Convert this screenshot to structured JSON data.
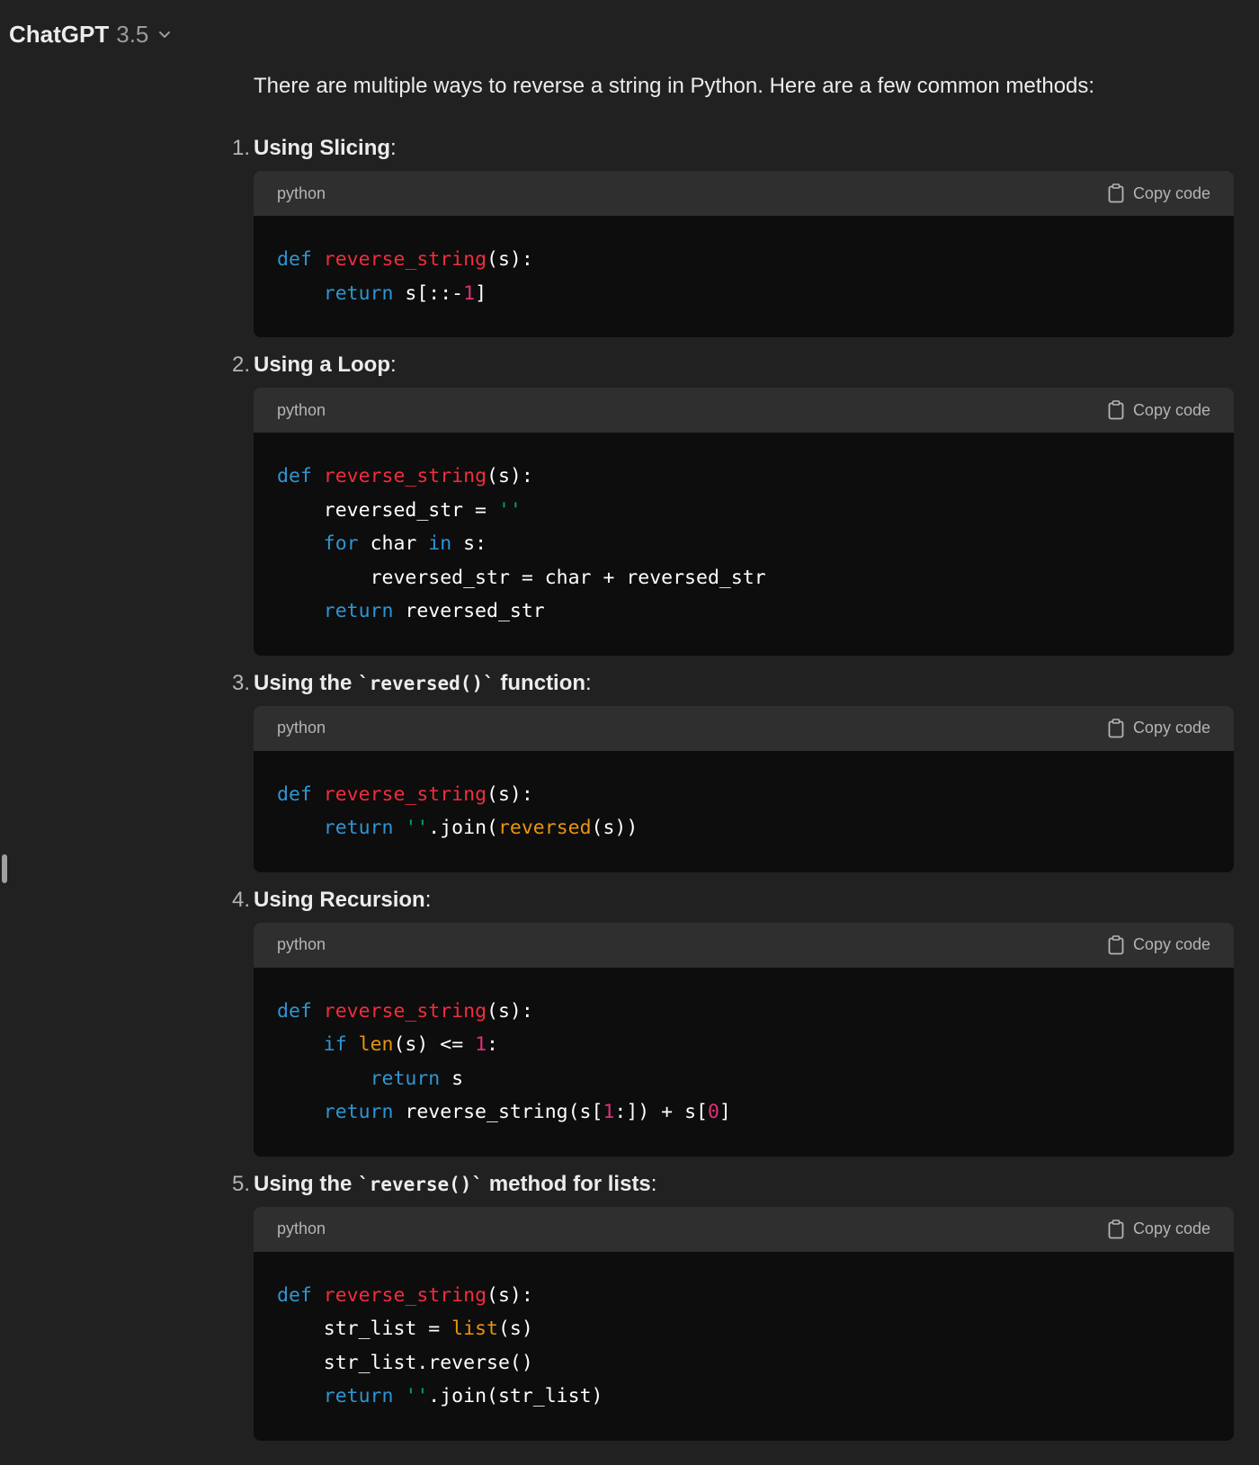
{
  "header": {
    "title": "ChatGPT",
    "version": "3.5"
  },
  "intro": "There are multiple ways to reverse a string in Python. Here are a few common methods:",
  "copy_label": "Copy code",
  "items": [
    {
      "number": "1.",
      "title": "Using Slicing",
      "lang": "python",
      "code": [
        [
          "def",
          "reverse_string",
          "(s):"
        ],
        [
          "return",
          "s[::-",
          "1",
          "]"
        ]
      ]
    },
    {
      "number": "2.",
      "title": "Using a Loop",
      "lang": "python",
      "code": [
        [
          "def",
          "reverse_string",
          "(s):"
        ],
        [
          "reversed_str = ",
          "''"
        ],
        [
          "for",
          " char ",
          "in",
          " s:"
        ],
        [
          "reversed_str = char + reversed_str"
        ],
        [
          "return",
          " reversed_str"
        ]
      ]
    },
    {
      "number": "3.",
      "title_prefix": "Using the",
      "title_code": "`reversed()`",
      "title_suffix": "function",
      "lang": "python",
      "code": [
        [
          "def",
          "reverse_string",
          "(s):"
        ],
        [
          "return",
          "''",
          ".join(",
          "reversed",
          "(s))"
        ]
      ]
    },
    {
      "number": "4.",
      "title": "Using Recursion",
      "lang": "python",
      "code": [
        [
          "def",
          "reverse_string",
          "(s):"
        ],
        [
          "if",
          "len",
          "(s) <= ",
          "1",
          ":"
        ],
        [
          "return",
          " s"
        ],
        [
          "return",
          " reverse_string(s[",
          "1",
          ":]) + s[",
          "0",
          "]"
        ]
      ]
    },
    {
      "number": "5.",
      "title_prefix": "Using the",
      "title_code": "`reverse()`",
      "title_suffix": "method for lists",
      "lang": "python",
      "code": [
        [
          "def",
          "reverse_string",
          "(s):"
        ],
        [
          "str_list = ",
          "list",
          "(s)"
        ],
        [
          "str_list.reverse()"
        ],
        [
          "return",
          "''",
          ".join(str_list)"
        ]
      ]
    }
  ],
  "colors": {
    "background": "#212121",
    "code_background": "#0d0d0d",
    "code_header": "#2f2f2f",
    "keyword": "#2e95d3",
    "function_name": "#f22c3d",
    "number": "#df3079",
    "string": "#00a67d",
    "builtin": "#e9950c"
  }
}
